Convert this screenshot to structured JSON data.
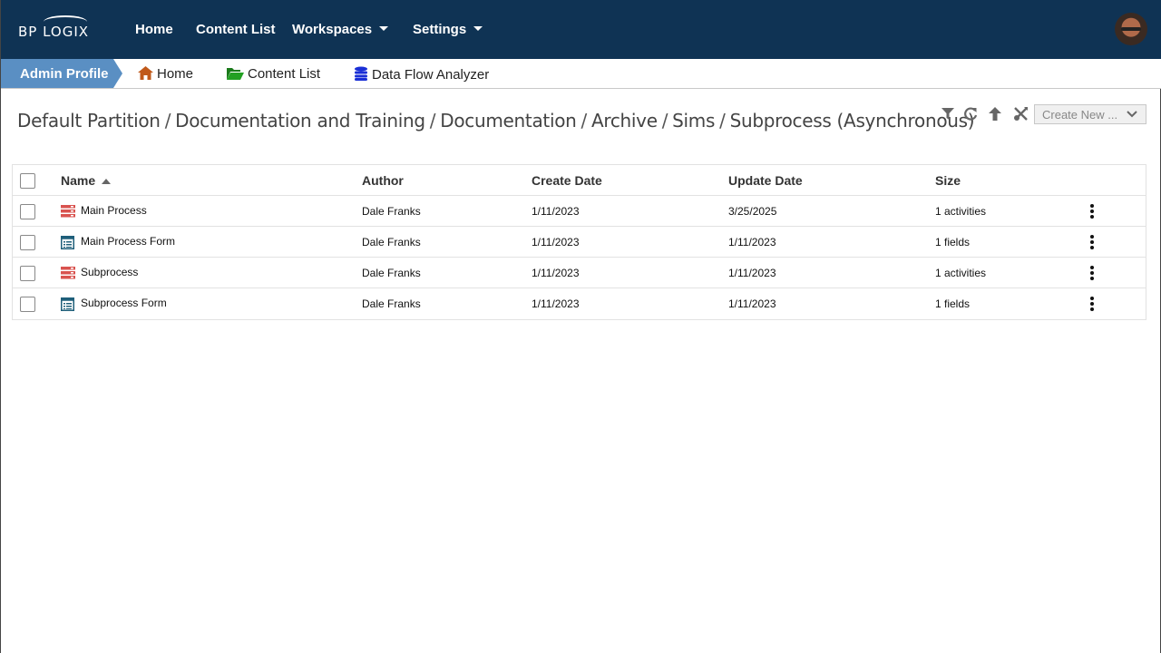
{
  "topbar": {
    "logo_text": "BP LOGIX",
    "nav": [
      {
        "label": "Home"
      },
      {
        "label": "Content List"
      },
      {
        "label": "Workspaces"
      },
      {
        "label": "Settings"
      }
    ]
  },
  "subbar": {
    "profile_label": "Admin Profile",
    "items": [
      {
        "label": "Home",
        "icon": "house-icon",
        "color": "#c0591a"
      },
      {
        "label": "Content List",
        "icon": "folder-open-icon",
        "color": "#1a8a1a"
      },
      {
        "label": "Data Flow Analyzer",
        "icon": "database-icon",
        "color": "#1a2fd6"
      }
    ]
  },
  "breadcrumb": {
    "items": [
      "Default Partition",
      "Documentation and Training",
      "Documentation",
      "Archive",
      "Sims",
      "Subprocess (Asynchronous)"
    ],
    "separator": "/"
  },
  "toolbar": {
    "create_label": "Create New ..."
  },
  "table": {
    "headers": {
      "name": "Name",
      "author": "Author",
      "create": "Create Date",
      "update": "Update Date",
      "size": "Size"
    },
    "rows": [
      {
        "name": "Main Process",
        "type": "process",
        "author": "Dale Franks",
        "create": "1/11/2023",
        "update": "3/25/2025",
        "size": "1 activities"
      },
      {
        "name": "Main Process Form",
        "type": "form",
        "author": "Dale Franks",
        "create": "1/11/2023",
        "update": "1/11/2023",
        "size": "1 fields"
      },
      {
        "name": "Subprocess",
        "type": "process",
        "author": "Dale Franks",
        "create": "1/11/2023",
        "update": "1/11/2023",
        "size": "1 activities"
      },
      {
        "name": "Subprocess Form",
        "type": "form",
        "author": "Dale Franks",
        "create": "1/11/2023",
        "update": "1/11/2023",
        "size": "1 fields"
      }
    ]
  },
  "colors": {
    "nav_bg": "#0f3354",
    "profile_tab": "#5a8fc3",
    "process_icon": "#d9534f",
    "form_icon": "#1f5f7a"
  }
}
